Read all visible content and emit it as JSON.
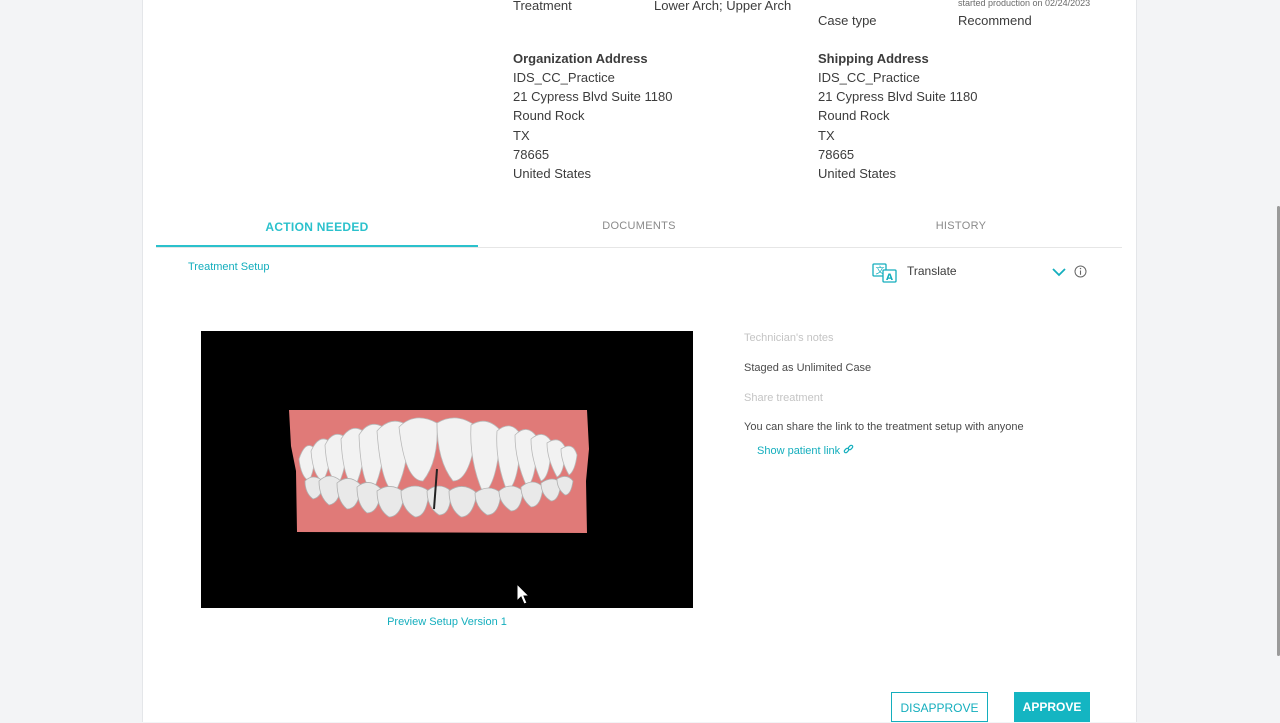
{
  "case_info": {
    "treatment_label": "Treatment",
    "treatment_value": "Lower Arch; Upper Arch",
    "production_note": "started production on 02/24/2023",
    "case_type_label": "Case type",
    "case_type_value": "Recommend"
  },
  "org_address": {
    "title": "Organization Address",
    "lines": [
      "IDS_CC_Practice",
      "21 Cypress Blvd Suite 1180",
      "Round Rock",
      "TX",
      "78665",
      "United States"
    ]
  },
  "shipping_address": {
    "title": "Shipping Address",
    "lines": [
      "IDS_CC_Practice",
      "21 Cypress Blvd Suite 1180",
      "Round Rock",
      "TX",
      "78665",
      "United States"
    ]
  },
  "tabs": [
    {
      "label": "ACTION NEEDED",
      "active": true
    },
    {
      "label": "DOCUMENTS",
      "active": false
    },
    {
      "label": "HISTORY",
      "active": false
    }
  ],
  "action_panel": {
    "section_title": "Treatment Setup",
    "translate_label": "Translate",
    "preview_link": "Preview Setup Version 1",
    "technician_notes_label": "Technician's notes",
    "technician_notes_text": "Staged as Unlimited Case",
    "share_label": "Share treatment",
    "share_text": "You can share the link to the treatment setup with anyone",
    "patient_link": "Show patient link"
  },
  "buttons": {
    "disapprove": "DISAPPROVE",
    "approve": "APPROVE"
  },
  "icons": {
    "translate": "translate-icon",
    "chevron": "chevron-down-icon",
    "info": "info-icon",
    "external_link": "link-icon",
    "cursor": "mouse-cursor-icon"
  },
  "colors": {
    "accent": "#2bc1cc",
    "link": "#14aebd",
    "approve": "#14b5c2",
    "gum": "#e07a78",
    "teeth": "#f2f2f2"
  }
}
